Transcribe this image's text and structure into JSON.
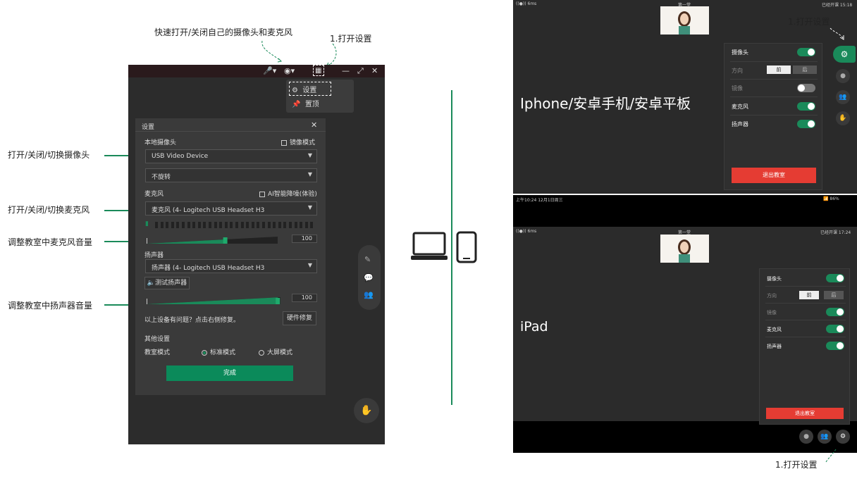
{
  "annotations": {
    "top_hint": "快速打开/关闭自己的摄像头和麦克风",
    "open_settings": "1.打开设置",
    "left_camera": "打开/关闭/切换摄像头",
    "left_mic": "打开/关闭/切换麦克风",
    "left_mic_volume": "调整教室中麦克风音量",
    "left_speaker_volume": "调整教室中扬声器音量",
    "accent_color": "#1a8a5a"
  },
  "desktop": {
    "menu": {
      "settings": "设置",
      "pin": "置顶"
    },
    "dialog": {
      "title": "设置",
      "local_camera": "本地摄像头",
      "mirror_mode": "镜像模式",
      "camera_device": "USB Video Device",
      "rotation": "不旋转",
      "microphone": "麦克风",
      "ai_noise": "AI智能降噪(体验)",
      "mic_device": "麦克风 (4- Logitech USB Headset H3",
      "mic_volume": "100",
      "mic_volume_fraction": 0.6,
      "speaker": "扬声器",
      "speaker_device": "扬声器 (4- Logitech USB Headset H3",
      "test_speaker": "测试扬声器",
      "speaker_volume": "100",
      "speaker_volume_fraction": 0.98,
      "device_problem": "以上设备有问题？点击右侧修复。",
      "hardware_fix": "硬件修复",
      "other_settings": "其他设置",
      "classroom_mode": "教室模式",
      "standard_mode": "标准模式",
      "large_mode": "大屏模式",
      "done": "完成"
    }
  },
  "phone": {
    "heading": "Iphone/安卓手机/安卓平板",
    "status_left": "6ms",
    "status_center": "第一堂",
    "status_right": "已经开课 15:18",
    "open_settings": "1.打开设置",
    "rows": {
      "camera": "摄像头",
      "direction": "方向",
      "front": "前",
      "back": "后",
      "mirror": "镜像",
      "mic": "麦克风",
      "speaker": "扬声器"
    },
    "exit": "退出教室"
  },
  "ipad": {
    "heading": "iPad",
    "sys_left": "上午10:24  12月1日周三",
    "sys_right": "86%",
    "status_left": "6ms",
    "status_center": "第一堂",
    "status_right": "已经开课 17:24",
    "rows": {
      "camera": "摄像头",
      "direction": "方向",
      "front": "前",
      "back": "后",
      "mirror": "镜像",
      "mic": "麦克风",
      "speaker": "扬声器"
    },
    "exit": "退出教室",
    "open_settings": "1.打开设置"
  }
}
